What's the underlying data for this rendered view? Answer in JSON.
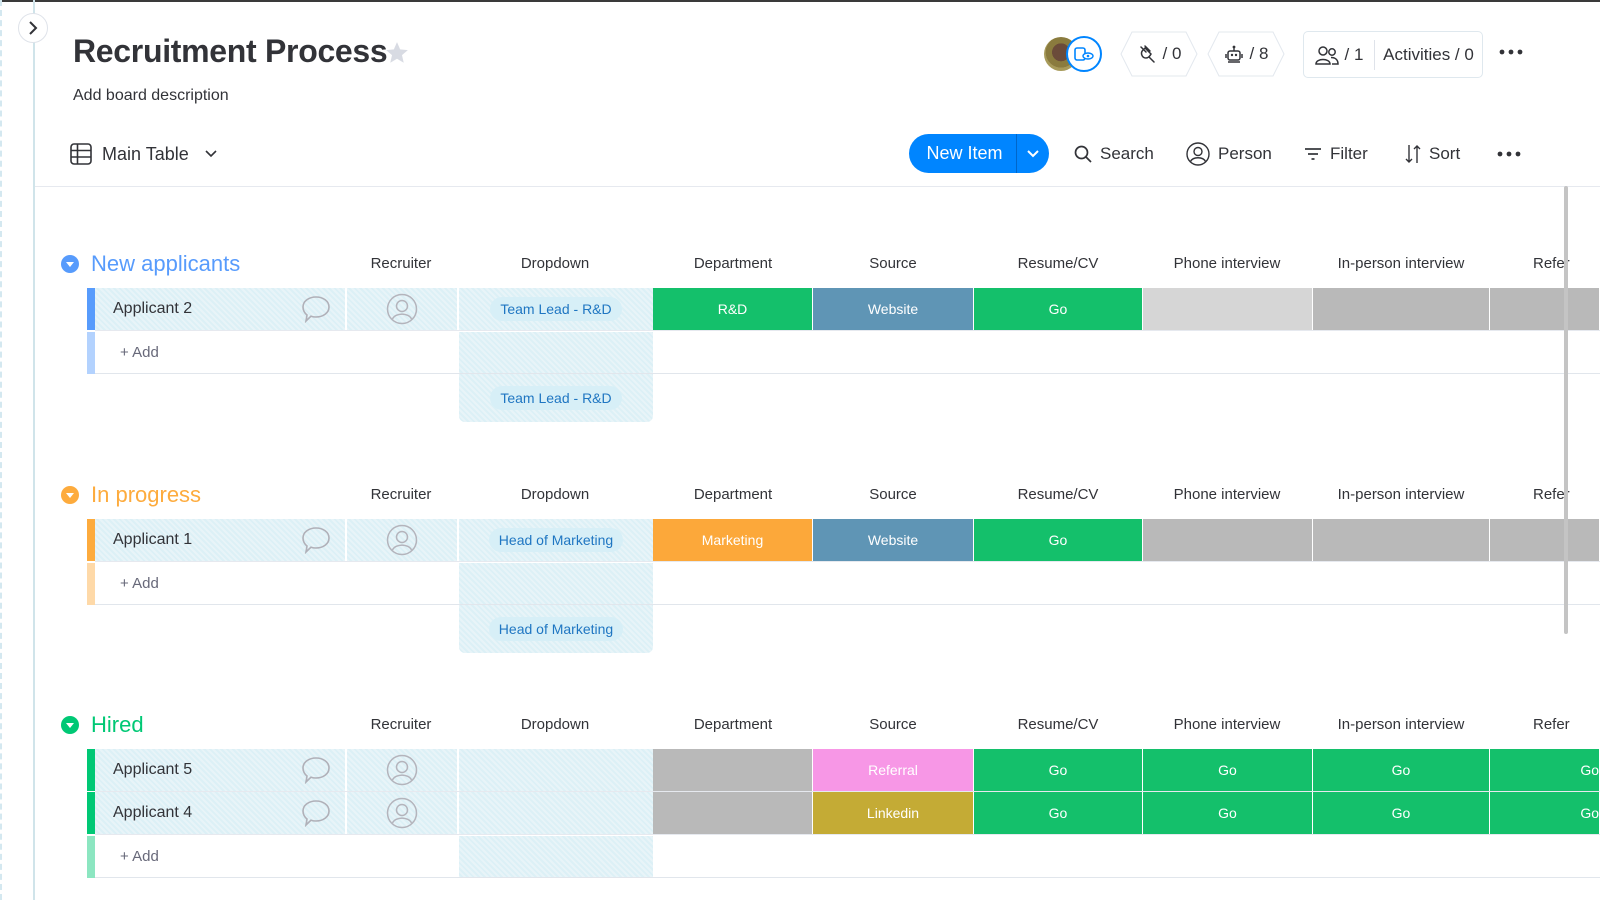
{
  "board": {
    "title": "Recruitment Process",
    "description": "Add board description"
  },
  "header": {
    "integrations_count": "/ 0",
    "automations_count": "/ 8",
    "members_count": "/ 1",
    "activities_label": "Activities / 0"
  },
  "toolbar": {
    "view_label": "Main Table",
    "new_item_label": "New Item",
    "search_label": "Search",
    "person_label": "Person",
    "filter_label": "Filter",
    "sort_label": "Sort"
  },
  "columns": [
    "Recruiter",
    "Dropdown",
    "Department",
    "Source",
    "Resume/CV",
    "Phone interview",
    "In-person interview",
    "Refer"
  ],
  "add_label": "+ Add",
  "colors": {
    "accent": "#0085ff",
    "group_new": "#579bfc",
    "group_progress": "#fdab3d",
    "group_hired": "#00c875",
    "status_green": "#14c06b",
    "status_blue": "#5f95b5",
    "status_orange": "#fca83a",
    "status_pink": "#f797e6",
    "status_olive": "#c4ab35",
    "status_gray": "#b9b9b9",
    "status_light_gray": "#d6d6d6"
  },
  "groups": [
    {
      "title": "New applicants",
      "color": "#579bfc",
      "dropdown_preview": "Team Lead - R&D",
      "rows": [
        {
          "name": "Applicant 2",
          "dropdown": "Team Lead - R&D",
          "department": {
            "label": "R&D",
            "color": "#14c06b"
          },
          "source": {
            "label": "Website",
            "color": "#5f95b5"
          },
          "resume": {
            "label": "Go",
            "color": "#14c06b"
          },
          "phone": {
            "label": "",
            "color": "#d6d6d6"
          },
          "inperson": {
            "label": "",
            "color": "#b9b9b9"
          },
          "refer": {
            "label": "",
            "color": "#b9b9b9"
          }
        }
      ]
    },
    {
      "title": "In progress",
      "color": "#fdab3d",
      "dropdown_preview": "Head of Marketing",
      "rows": [
        {
          "name": "Applicant 1",
          "dropdown": "Head of Marketing",
          "department": {
            "label": "Marketing",
            "color": "#fca83a"
          },
          "source": {
            "label": "Website",
            "color": "#5f95b5"
          },
          "resume": {
            "label": "Go",
            "color": "#14c06b"
          },
          "phone": {
            "label": "",
            "color": "#b9b9b9"
          },
          "inperson": {
            "label": "",
            "color": "#b9b9b9"
          },
          "refer": {
            "label": "",
            "color": "#b9b9b9"
          }
        }
      ]
    },
    {
      "title": "Hired",
      "color": "#00c875",
      "dropdown_preview": "",
      "rows": [
        {
          "name": "Applicant 5",
          "dropdown": "",
          "department": {
            "label": "",
            "color": "#b9b9b9"
          },
          "source": {
            "label": "Referral",
            "color": "#f797e6"
          },
          "resume": {
            "label": "Go",
            "color": "#14c06b"
          },
          "phone": {
            "label": "Go",
            "color": "#14c06b"
          },
          "inperson": {
            "label": "Go",
            "color": "#14c06b"
          },
          "refer": {
            "label": "Go",
            "color": "#14c06b"
          }
        },
        {
          "name": "Applicant 4",
          "dropdown": "",
          "department": {
            "label": "",
            "color": "#b9b9b9"
          },
          "source": {
            "label": "Linkedin",
            "color": "#c4ab35"
          },
          "resume": {
            "label": "Go",
            "color": "#14c06b"
          },
          "phone": {
            "label": "Go",
            "color": "#14c06b"
          },
          "inperson": {
            "label": "Go",
            "color": "#14c06b"
          },
          "refer": {
            "label": "Go",
            "color": "#14c06b"
          }
        }
      ]
    }
  ]
}
